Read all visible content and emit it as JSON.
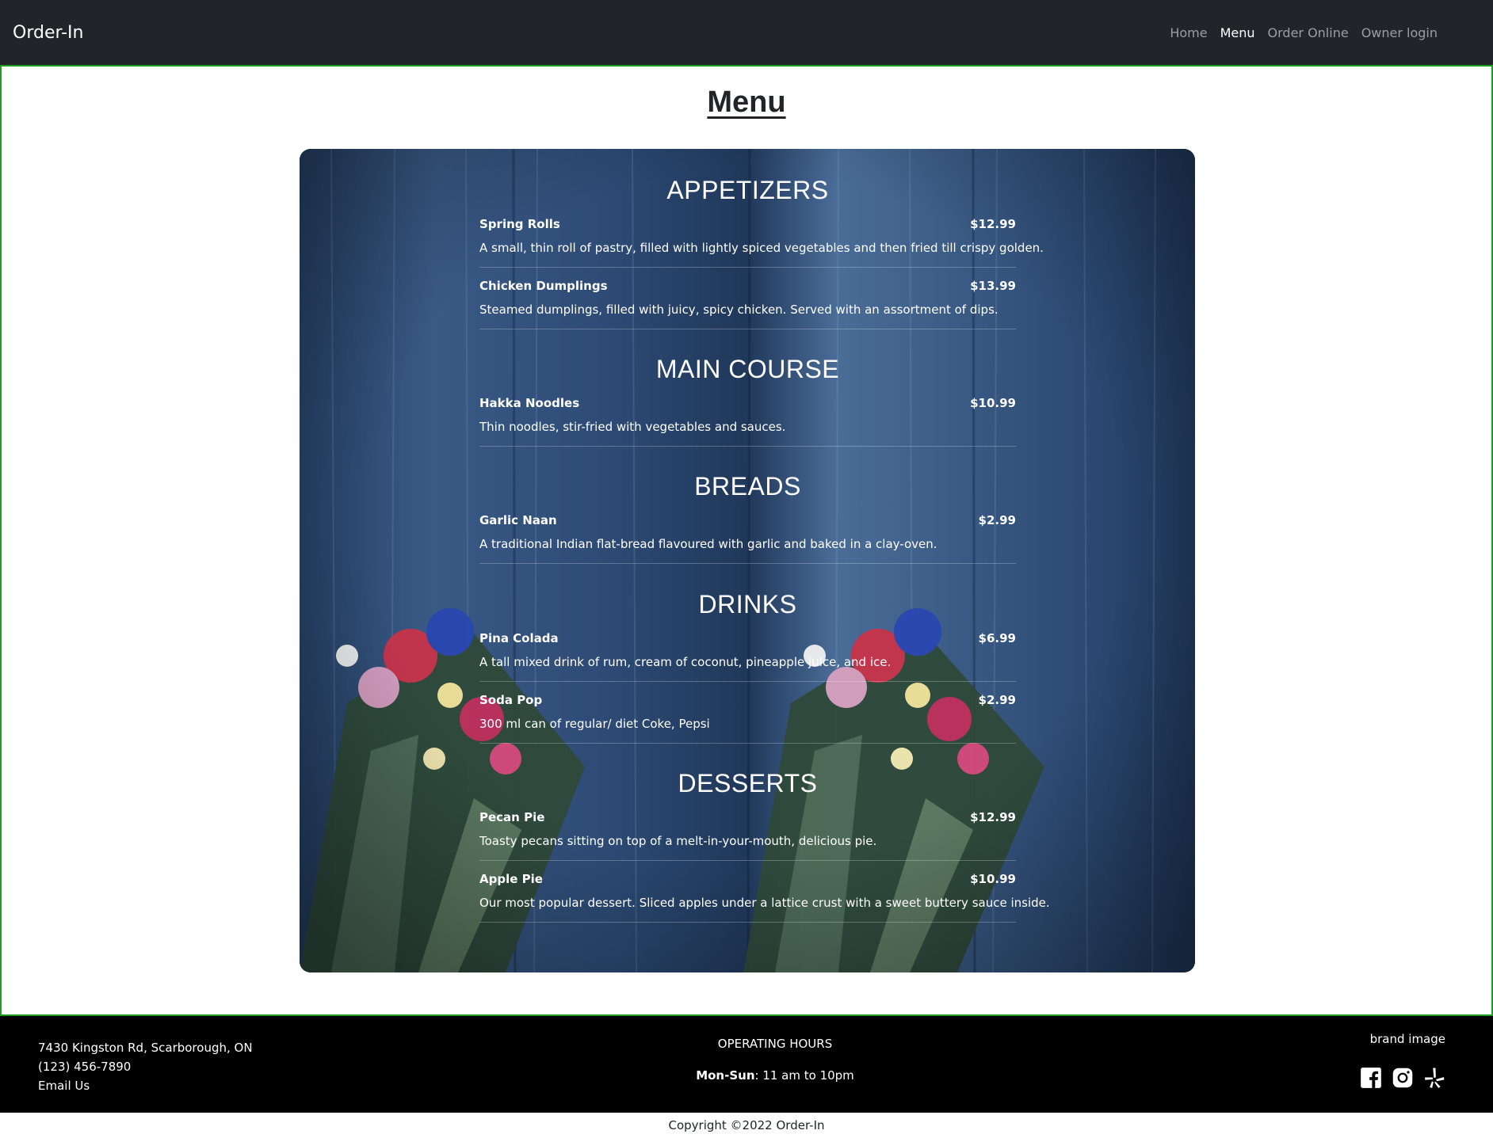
{
  "nav": {
    "brand": "Order-In",
    "links": [
      "Home",
      "Menu",
      "Order Online",
      "Owner login"
    ]
  },
  "page": {
    "title": "Menu"
  },
  "menu": {
    "sections": [
      {
        "title": "APPETIZERS",
        "items": [
          {
            "name": "Spring Rolls",
            "price": "$12.99",
            "desc": "A small, thin roll of pastry, filled with lightly spiced vegetables and then fried till crispy golden."
          },
          {
            "name": "Chicken Dumplings",
            "price": "$13.99",
            "desc": "Steamed dumplings, filled with juicy, spicy chicken. Served with an assortment of dips."
          }
        ]
      },
      {
        "title": "MAIN COURSE",
        "items": [
          {
            "name": "Hakka Noodles",
            "price": "$10.99",
            "desc": "Thin noodles, stir-fried with vegetables and sauces."
          }
        ]
      },
      {
        "title": "BREADS",
        "items": [
          {
            "name": "Garlic Naan",
            "price": "$2.99",
            "desc": "A traditional Indian flat-bread flavoured with garlic and baked in a clay-oven."
          }
        ]
      },
      {
        "title": "DRINKS",
        "items": [
          {
            "name": "Pina Colada",
            "price": "$6.99",
            "desc": "A tall mixed drink of rum, cream of coconut, pineapple juice, and ice."
          },
          {
            "name": "Soda Pop",
            "price": "$2.99",
            "desc": "300 ml can of regular/ diet Coke, Pepsi"
          }
        ]
      },
      {
        "title": "DESSERTS",
        "items": [
          {
            "name": "Pecan Pie",
            "price": "$12.99",
            "desc": "Toasty pecans sitting on top of a melt-in-your-mouth, delicious pie."
          },
          {
            "name": "Apple Pie",
            "price": "$10.99",
            "desc": "Our most popular dessert. Sliced apples under a lattice crust with a sweet buttery sauce inside."
          }
        ]
      }
    ]
  },
  "footer": {
    "address": "7430 Kingston Rd, Scarborough, ON",
    "phone": "(123) 456-7890",
    "email_label": "Email Us",
    "hours_title": "OPERATING HOURS",
    "hours_days": "Mon-Sun",
    "hours_time": ": 11 am to 10pm",
    "brand_image_alt": "brand image",
    "socials": [
      "facebook-icon",
      "instagram-icon",
      "yelp-icon"
    ]
  },
  "copyright": "Copyright ©2022 Order-In",
  "colors": {
    "navbar": "#212529",
    "footer": "#000000",
    "main_border": "#1e9c1e",
    "menu_bg": "#2d4a73"
  }
}
